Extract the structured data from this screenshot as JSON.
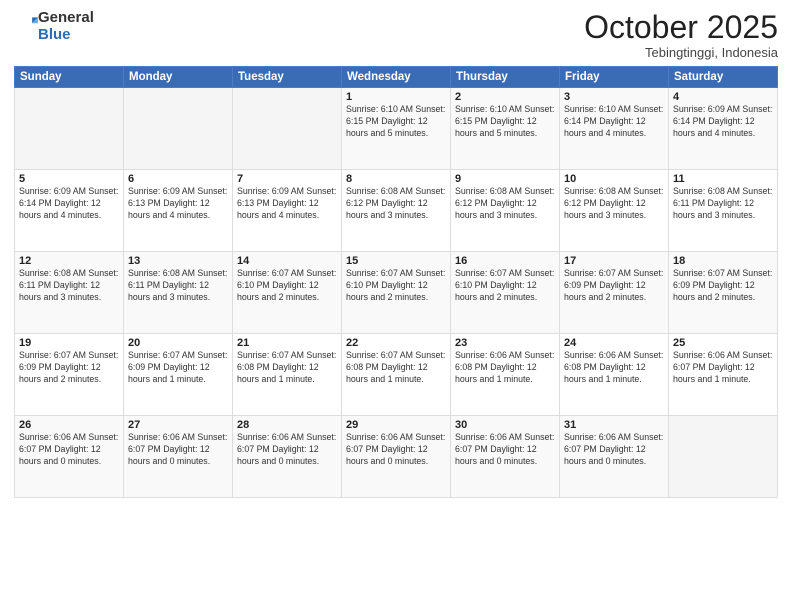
{
  "logo": {
    "general": "General",
    "blue": "Blue"
  },
  "header": {
    "month": "October 2025",
    "location": "Tebingtinggi, Indonesia"
  },
  "days_of_week": [
    "Sunday",
    "Monday",
    "Tuesday",
    "Wednesday",
    "Thursday",
    "Friday",
    "Saturday"
  ],
  "weeks": [
    [
      {
        "day": "",
        "info": ""
      },
      {
        "day": "",
        "info": ""
      },
      {
        "day": "",
        "info": ""
      },
      {
        "day": "1",
        "info": "Sunrise: 6:10 AM\nSunset: 6:15 PM\nDaylight: 12 hours\nand 5 minutes."
      },
      {
        "day": "2",
        "info": "Sunrise: 6:10 AM\nSunset: 6:15 PM\nDaylight: 12 hours\nand 5 minutes."
      },
      {
        "day": "3",
        "info": "Sunrise: 6:10 AM\nSunset: 6:14 PM\nDaylight: 12 hours\nand 4 minutes."
      },
      {
        "day": "4",
        "info": "Sunrise: 6:09 AM\nSunset: 6:14 PM\nDaylight: 12 hours\nand 4 minutes."
      }
    ],
    [
      {
        "day": "5",
        "info": "Sunrise: 6:09 AM\nSunset: 6:14 PM\nDaylight: 12 hours\nand 4 minutes."
      },
      {
        "day": "6",
        "info": "Sunrise: 6:09 AM\nSunset: 6:13 PM\nDaylight: 12 hours\nand 4 minutes."
      },
      {
        "day": "7",
        "info": "Sunrise: 6:09 AM\nSunset: 6:13 PM\nDaylight: 12 hours\nand 4 minutes."
      },
      {
        "day": "8",
        "info": "Sunrise: 6:08 AM\nSunset: 6:12 PM\nDaylight: 12 hours\nand 3 minutes."
      },
      {
        "day": "9",
        "info": "Sunrise: 6:08 AM\nSunset: 6:12 PM\nDaylight: 12 hours\nand 3 minutes."
      },
      {
        "day": "10",
        "info": "Sunrise: 6:08 AM\nSunset: 6:12 PM\nDaylight: 12 hours\nand 3 minutes."
      },
      {
        "day": "11",
        "info": "Sunrise: 6:08 AM\nSunset: 6:11 PM\nDaylight: 12 hours\nand 3 minutes."
      }
    ],
    [
      {
        "day": "12",
        "info": "Sunrise: 6:08 AM\nSunset: 6:11 PM\nDaylight: 12 hours\nand 3 minutes."
      },
      {
        "day": "13",
        "info": "Sunrise: 6:08 AM\nSunset: 6:11 PM\nDaylight: 12 hours\nand 3 minutes."
      },
      {
        "day": "14",
        "info": "Sunrise: 6:07 AM\nSunset: 6:10 PM\nDaylight: 12 hours\nand 2 minutes."
      },
      {
        "day": "15",
        "info": "Sunrise: 6:07 AM\nSunset: 6:10 PM\nDaylight: 12 hours\nand 2 minutes."
      },
      {
        "day": "16",
        "info": "Sunrise: 6:07 AM\nSunset: 6:10 PM\nDaylight: 12 hours\nand 2 minutes."
      },
      {
        "day": "17",
        "info": "Sunrise: 6:07 AM\nSunset: 6:09 PM\nDaylight: 12 hours\nand 2 minutes."
      },
      {
        "day": "18",
        "info": "Sunrise: 6:07 AM\nSunset: 6:09 PM\nDaylight: 12 hours\nand 2 minutes."
      }
    ],
    [
      {
        "day": "19",
        "info": "Sunrise: 6:07 AM\nSunset: 6:09 PM\nDaylight: 12 hours\nand 2 minutes."
      },
      {
        "day": "20",
        "info": "Sunrise: 6:07 AM\nSunset: 6:09 PM\nDaylight: 12 hours\nand 1 minute."
      },
      {
        "day": "21",
        "info": "Sunrise: 6:07 AM\nSunset: 6:08 PM\nDaylight: 12 hours\nand 1 minute."
      },
      {
        "day": "22",
        "info": "Sunrise: 6:07 AM\nSunset: 6:08 PM\nDaylight: 12 hours\nand 1 minute."
      },
      {
        "day": "23",
        "info": "Sunrise: 6:06 AM\nSunset: 6:08 PM\nDaylight: 12 hours\nand 1 minute."
      },
      {
        "day": "24",
        "info": "Sunrise: 6:06 AM\nSunset: 6:08 PM\nDaylight: 12 hours\nand 1 minute."
      },
      {
        "day": "25",
        "info": "Sunrise: 6:06 AM\nSunset: 6:07 PM\nDaylight: 12 hours\nand 1 minute."
      }
    ],
    [
      {
        "day": "26",
        "info": "Sunrise: 6:06 AM\nSunset: 6:07 PM\nDaylight: 12 hours\nand 0 minutes."
      },
      {
        "day": "27",
        "info": "Sunrise: 6:06 AM\nSunset: 6:07 PM\nDaylight: 12 hours\nand 0 minutes."
      },
      {
        "day": "28",
        "info": "Sunrise: 6:06 AM\nSunset: 6:07 PM\nDaylight: 12 hours\nand 0 minutes."
      },
      {
        "day": "29",
        "info": "Sunrise: 6:06 AM\nSunset: 6:07 PM\nDaylight: 12 hours\nand 0 minutes."
      },
      {
        "day": "30",
        "info": "Sunrise: 6:06 AM\nSunset: 6:07 PM\nDaylight: 12 hours\nand 0 minutes."
      },
      {
        "day": "31",
        "info": "Sunrise: 6:06 AM\nSunset: 6:07 PM\nDaylight: 12 hours\nand 0 minutes."
      },
      {
        "day": "",
        "info": ""
      }
    ]
  ]
}
